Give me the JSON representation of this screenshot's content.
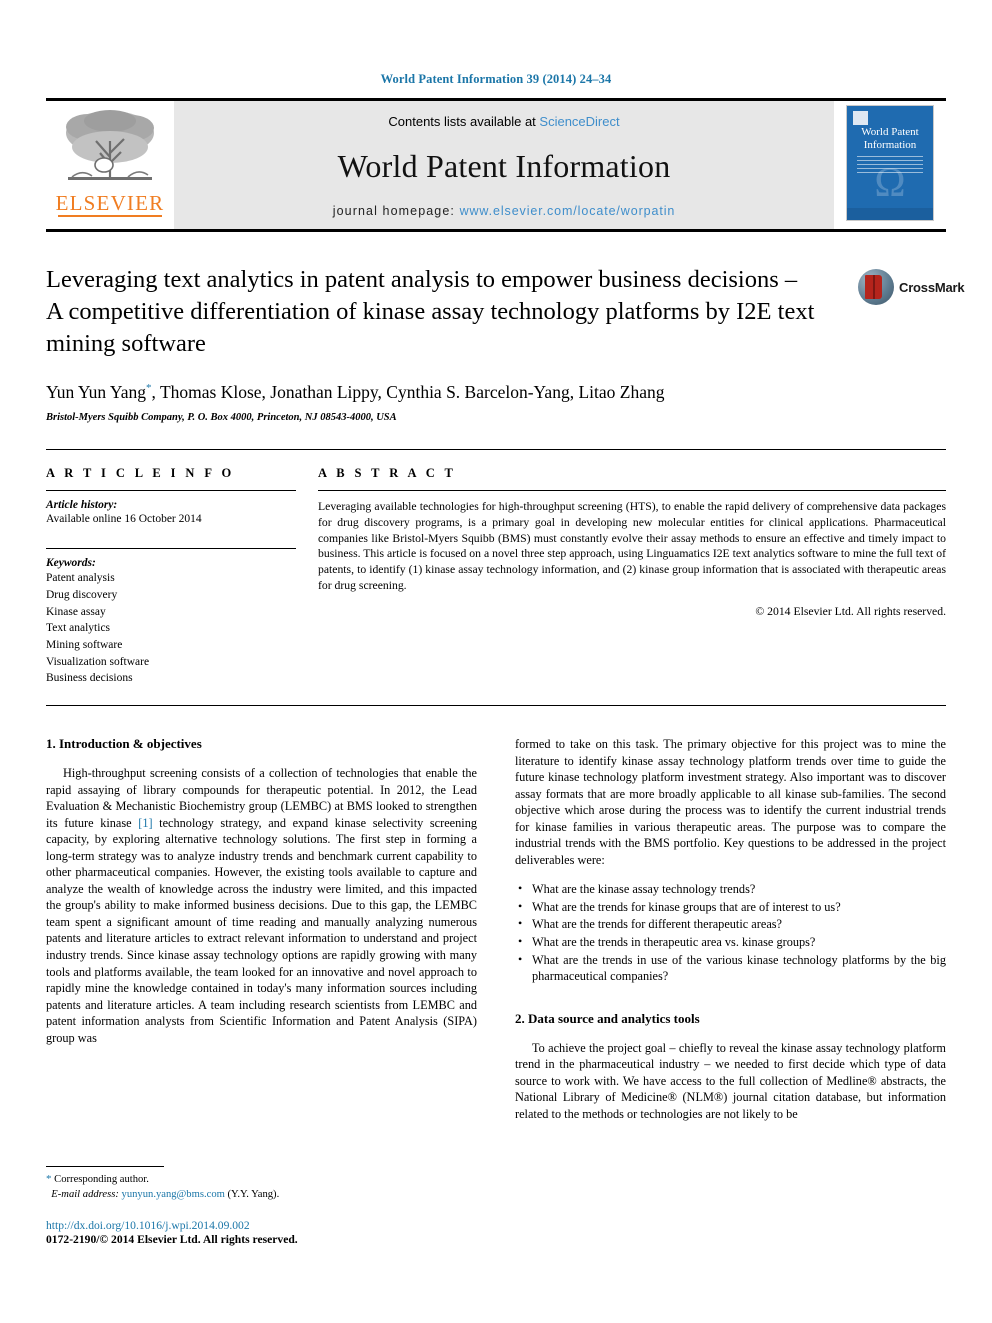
{
  "running_head": "World Patent Information 39 (2014) 24–34",
  "header": {
    "contents_prefix": "Contents lists available at ",
    "sciencedirect": "ScienceDirect",
    "journal_title": "World Patent Information",
    "homepage_prefix": "journal homepage: ",
    "homepage_url": "www.elsevier.com/locate/worpatin",
    "publisher_name": "ELSEVIER",
    "cover_title_line1": "World Patent",
    "cover_title_line2": "Information",
    "link_color": "#3f8ecb",
    "band_background": "#e7e7e7",
    "cover_background": "#1f6bb0",
    "publisher_color": "#f07d22"
  },
  "article": {
    "title": "Leveraging text analytics in patent analysis to empower business decisions – A competitive differentiation of kinase assay technology platforms by I2E text mining software",
    "authors": "Yun Yun Yang, Thomas Klose, Jonathan Lippy, Cynthia S. Barcelon-Yang, Litao Zhang",
    "author_marker": "*",
    "affiliation": "Bristol-Myers Squibb Company, P. O. Box 4000, Princeton, NJ 08543-4000, USA",
    "crossmark_label": "CrossMark"
  },
  "article_info": {
    "heading": "A R T I C L E  I N F O",
    "history_label": "Article history:",
    "history_value": "Available online 16 October 2014",
    "keywords_label": "Keywords:",
    "keywords": [
      "Patent analysis",
      "Drug discovery",
      "Kinase assay",
      "Text analytics",
      "Mining software",
      "Visualization software",
      "Business decisions"
    ]
  },
  "abstract": {
    "heading": "A B S T R A C T",
    "text": "Leveraging available technologies for high-throughput screening (HTS), to enable the rapid delivery of comprehensive data packages for drug discovery programs, is a primary goal in developing new molecular entities for clinical applications. Pharmaceutical companies like Bristol-Myers Squibb (BMS) must constantly evolve their assay methods to ensure an effective and timely impact to business. This article is focused on a novel three step approach, using Linguamatics I2E text analytics software to mine the full text of patents, to identify (1) kinase assay technology information, and (2) kinase group information that is associated with therapeutic areas for drug screening.",
    "copyright": "© 2014 Elsevier Ltd. All rights reserved."
  },
  "sections": {
    "intro_heading": "1. Introduction & objectives",
    "intro_para1_a": "High-throughput screening consists of a collection of technologies that enable the rapid assaying of library compounds for therapeutic potential. In 2012, the Lead Evaluation & Mechanistic Biochemistry group (LEMBC) at BMS looked to strengthen its future kinase ",
    "intro_ref": "[1]",
    "intro_para1_b": " technology strategy, and expand kinase selectivity screening capacity, by exploring alternative technology solutions. The first step in forming a long-term strategy was to analyze industry trends and benchmark current capability to other pharmaceutical companies. However, the existing tools available to capture and analyze the wealth of knowledge across the industry were limited, and this impacted the group's ability to make informed business decisions. Due to this gap, the LEMBC team spent a significant amount of time reading and manually analyzing numerous patents and literature articles to extract relevant information to understand and project industry trends. Since kinase assay technology options are rapidly growing with many tools and platforms available, the team looked for an innovative and novel approach to rapidly mine the knowledge contained in today's many information sources including patents and literature articles. A team including research scientists from LEMBC and patent information analysts from Scientific Information and Patent Analysis (SIPA) group was",
    "intro_para2": "formed to take on this task. The primary objective for this project was to mine the literature to identify kinase assay technology platform trends over time to guide the future kinase technology platform investment strategy. Also important was to discover assay formats that are more broadly applicable to all kinase sub-families. The second objective which arose during the process was to identify the current industrial trends for kinase families in various therapeutic areas. The purpose was to compare the industrial trends with the BMS portfolio. Key questions to be addressed in the project deliverables were:",
    "questions": [
      "What are the kinase assay technology trends?",
      "What are the trends for kinase groups that are of interest to us?",
      "What are the trends for different therapeutic areas?",
      "What are the trends in therapeutic area vs. kinase groups?",
      "What are the trends in use of the various kinase technology platforms by the big pharmaceutical companies?"
    ],
    "data_heading": "2. Data source and analytics tools",
    "data_para": "To achieve the project goal – chiefly to reveal the kinase assay technology platform trend in the pharmaceutical industry – we needed to first decide which type of data source to work with. We have access to the full collection of Medline® abstracts, the National Library of Medicine® (NLM®) journal citation database, but information related to the methods or technologies are not likely to be"
  },
  "footnote": {
    "corresponding_marker": "*",
    "corresponding_text": "Corresponding author.",
    "email_label": "E-mail address:",
    "email": "yunyun.yang@bms.com",
    "email_owner": "(Y.Y. Yang)."
  },
  "footer": {
    "doi": "http://dx.doi.org/10.1016/j.wpi.2014.09.002",
    "issn_line": "0172-2190/© 2014 Elsevier Ltd. All rights reserved."
  }
}
